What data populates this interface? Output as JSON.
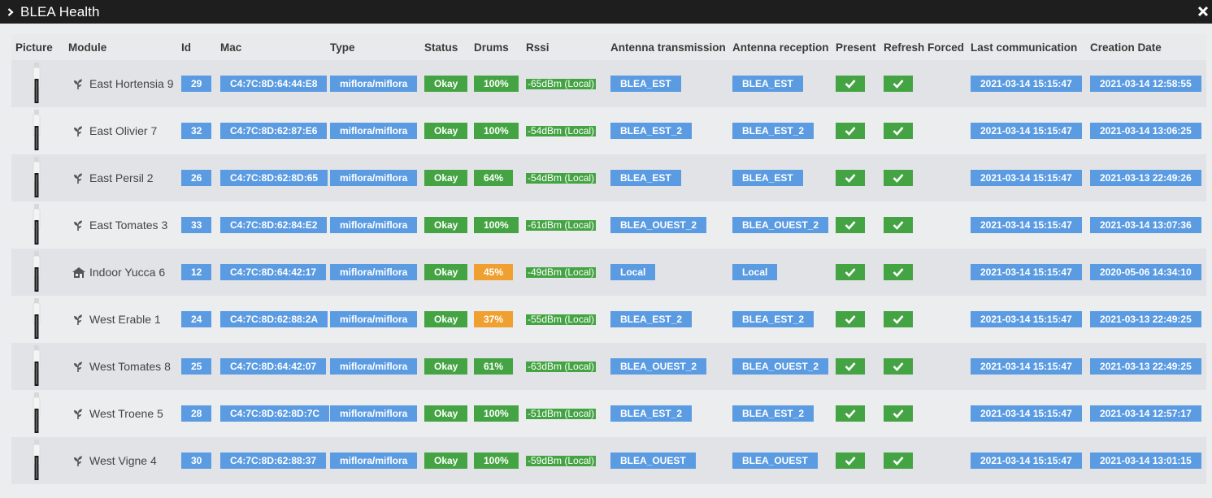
{
  "window": {
    "title": "BLEA Health"
  },
  "colors": {
    "blue": "#5a9be2",
    "green": "#44a443",
    "orange": "#f0a030",
    "titlebar": "#1e1e1e"
  },
  "columns": [
    "Picture",
    "Module",
    "Id",
    "Mac",
    "Type",
    "Status",
    "Drums",
    "Rssi",
    "Antenna transmission",
    "Antenna reception",
    "Present",
    "Refresh Forced",
    "Last communication",
    "Creation Date"
  ],
  "rows": [
    {
      "icon": "plant-icon",
      "module": "East Hortensia 9",
      "id": "29",
      "mac": "C4:7C:8D:64:44:E8",
      "type": "miflora/miflora",
      "status": "Okay",
      "drums": "100%",
      "drums_level": "green",
      "rssi": "-65dBm (Local)",
      "ant_tx": "BLEA_EST",
      "ant_rx": "BLEA_EST",
      "present": true,
      "refresh": true,
      "last": "2021-03-14 15:15:47",
      "created": "2021-03-14 12:58:55"
    },
    {
      "icon": "plant-icon",
      "module": "East Olivier 7",
      "id": "32",
      "mac": "C4:7C:8D:62:87:E6",
      "type": "miflora/miflora",
      "status": "Okay",
      "drums": "100%",
      "drums_level": "green",
      "rssi": "-54dBm (Local)",
      "ant_tx": "BLEA_EST_2",
      "ant_rx": "BLEA_EST_2",
      "present": true,
      "refresh": true,
      "last": "2021-03-14 15:15:47",
      "created": "2021-03-14 13:06:25"
    },
    {
      "icon": "plant-icon",
      "module": "East Persil 2",
      "id": "26",
      "mac": "C4:7C:8D:62:8D:65",
      "type": "miflora/miflora",
      "status": "Okay",
      "drums": "64%",
      "drums_level": "green",
      "rssi": "-54dBm (Local)",
      "ant_tx": "BLEA_EST",
      "ant_rx": "BLEA_EST",
      "present": true,
      "refresh": true,
      "last": "2021-03-14 15:15:47",
      "created": "2021-03-13 22:49:26"
    },
    {
      "icon": "plant-icon",
      "module": "East Tomates 3",
      "id": "33",
      "mac": "C4:7C:8D:62:84:E2",
      "type": "miflora/miflora",
      "status": "Okay",
      "drums": "100%",
      "drums_level": "green",
      "rssi": "-61dBm (Local)",
      "ant_tx": "BLEA_OUEST_2",
      "ant_rx": "BLEA_OUEST_2",
      "present": true,
      "refresh": true,
      "last": "2021-03-14 15:15:47",
      "created": "2021-03-14 13:07:36"
    },
    {
      "icon": "house-icon",
      "module": "Indoor Yucca 6",
      "id": "12",
      "mac": "C4:7C:8D:64:42:17",
      "type": "miflora/miflora",
      "status": "Okay",
      "drums": "45%",
      "drums_level": "orange",
      "rssi": "-49dBm (Local)",
      "ant_tx": "Local",
      "ant_rx": "Local",
      "present": true,
      "refresh": true,
      "last": "2021-03-14 15:15:47",
      "created": "2020-05-06 14:34:10"
    },
    {
      "icon": "plant-icon",
      "module": "West Erable 1",
      "id": "24",
      "mac": "C4:7C:8D:62:88:2A",
      "type": "miflora/miflora",
      "status": "Okay",
      "drums": "37%",
      "drums_level": "orange",
      "rssi": "-55dBm (Local)",
      "ant_tx": "BLEA_EST_2",
      "ant_rx": "BLEA_EST_2",
      "present": true,
      "refresh": true,
      "last": "2021-03-14 15:15:47",
      "created": "2021-03-13 22:49:25"
    },
    {
      "icon": "plant-icon",
      "module": "West Tomates 8",
      "id": "25",
      "mac": "C4:7C:8D:64:42:07",
      "type": "miflora/miflora",
      "status": "Okay",
      "drums": "61%",
      "drums_level": "green",
      "rssi": "-63dBm (Local)",
      "ant_tx": "BLEA_OUEST_2",
      "ant_rx": "BLEA_OUEST_2",
      "present": true,
      "refresh": true,
      "last": "2021-03-14 15:15:47",
      "created": "2021-03-13 22:49:25"
    },
    {
      "icon": "plant-icon",
      "module": "West Troene 5",
      "id": "28",
      "mac": "C4:7C:8D:62:8D:7C",
      "type": "miflora/miflora",
      "status": "Okay",
      "drums": "100%",
      "drums_level": "green",
      "rssi": "-51dBm (Local)",
      "ant_tx": "BLEA_EST_2",
      "ant_rx": "BLEA_EST_2",
      "present": true,
      "refresh": true,
      "last": "2021-03-14 15:15:47",
      "created": "2021-03-14 12:57:17"
    },
    {
      "icon": "plant-icon",
      "module": "West Vigne 4",
      "id": "30",
      "mac": "C4:7C:8D:62:88:37",
      "type": "miflora/miflora",
      "status": "Okay",
      "drums": "100%",
      "drums_level": "green",
      "rssi": "-59dBm (Local)",
      "ant_tx": "BLEA_OUEST",
      "ant_rx": "BLEA_OUEST",
      "present": true,
      "refresh": true,
      "last": "2021-03-14 15:15:47",
      "created": "2021-03-14 13:01:15"
    }
  ]
}
